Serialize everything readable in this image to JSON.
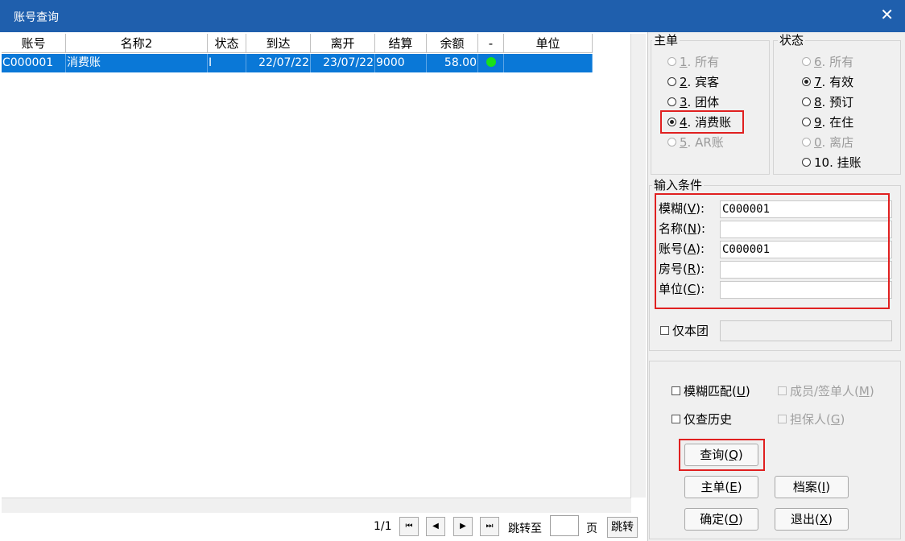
{
  "window": {
    "title": "账号查询",
    "close": "✕"
  },
  "grid": {
    "columns": [
      "账号",
      "名称2",
      "状态",
      "到达",
      "离开",
      "结算",
      "余额",
      "-",
      "单位"
    ],
    "rows": [
      {
        "account": "C000001",
        "name": "消费账",
        "status": "I",
        "arrive": "22/07/22",
        "depart": "23/07/22",
        "settle": "9000",
        "balance": "58.00",
        "unit": ""
      }
    ]
  },
  "pager": {
    "page": "1/1",
    "jump_label": "跳转至",
    "page_unit": "页",
    "jump_button": "跳转",
    "first": "⏮",
    "prev": "◀",
    "next": "▶",
    "last": "⏭"
  },
  "main_group": {
    "title": "主单",
    "options": [
      {
        "num": "1",
        "text": ". 所有"
      },
      {
        "num": "2",
        "text": ". 宾客"
      },
      {
        "num": "3",
        "text": ". 团体"
      },
      {
        "num": "4",
        "text": ". 消费账"
      },
      {
        "num": "5",
        "text": ". AR账"
      }
    ]
  },
  "status_group": {
    "title": "状态",
    "options": [
      {
        "num": "6",
        "text": ". 所有"
      },
      {
        "num": "7",
        "text": ". 有效"
      },
      {
        "num": "8",
        "text": ". 预订"
      },
      {
        "num": "9",
        "text": ". 在住"
      },
      {
        "num": "0",
        "text": ". 离店"
      },
      {
        "num": "10",
        "text": ". 挂账"
      }
    ]
  },
  "conditions": {
    "title": "输入条件",
    "fields": [
      {
        "label": "模糊",
        "key": "V",
        "value": "C000001"
      },
      {
        "label": "名称",
        "key": "N",
        "value": ""
      },
      {
        "label": "账号",
        "key": "A",
        "value": "C000001"
      },
      {
        "label": "房号",
        "key": "R",
        "value": ""
      },
      {
        "label": "单位",
        "key": "C",
        "value": ""
      }
    ],
    "group_only": "仅本团"
  },
  "options": {
    "fuzzy": {
      "label": "模糊匹配",
      "key": "U"
    },
    "member": {
      "label": "成员/签单人",
      "key": "M"
    },
    "history": {
      "label": "仅查历史",
      "key": ""
    },
    "guarantor": {
      "label": "担保人",
      "key": "G"
    }
  },
  "buttons": {
    "query": {
      "label": "查询",
      "key": "Q"
    },
    "master": {
      "label": "主单",
      "key": "E"
    },
    "archive": {
      "label": "档案",
      "key": "I"
    },
    "ok": {
      "label": "确定",
      "key": "O"
    },
    "exit": {
      "label": "退出",
      "key": "X"
    }
  },
  "colors": {
    "titlebar": "#1f5fad",
    "selection": "#0a78d7",
    "highlight": "#e02020",
    "status_dot": "#19e01a"
  }
}
